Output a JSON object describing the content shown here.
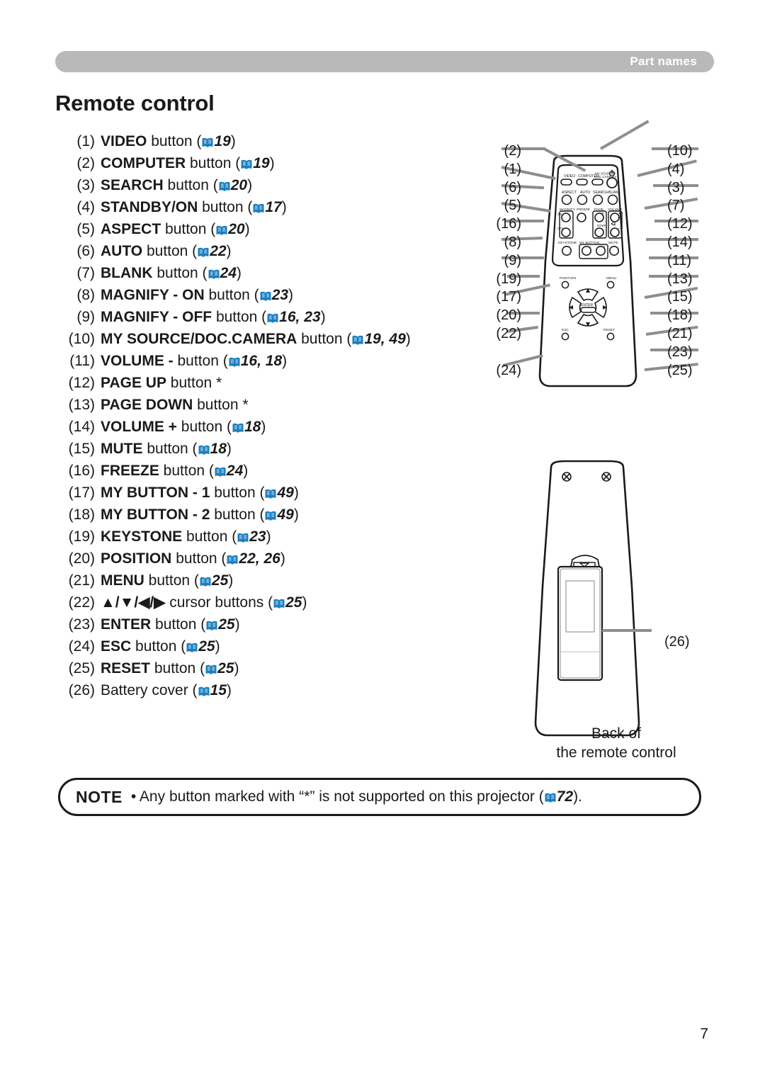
{
  "header": {
    "section_label": "Part names"
  },
  "page_title": "Remote control",
  "items": [
    {
      "num": "(1)",
      "bold": "VIDEO",
      "tail": " button (",
      "icon": "book-icon",
      "ref": "19",
      "close": ")"
    },
    {
      "num": "(2)",
      "bold": "COMPUTER",
      "tail": " button (",
      "icon": "book-icon",
      "ref": "19",
      "close": ")"
    },
    {
      "num": "(3)",
      "bold": "SEARCH",
      "tail": " button (",
      "icon": "book-icon",
      "ref": "20",
      "close": ")"
    },
    {
      "num": "(4)",
      "bold": "STANDBY/ON",
      "tail": " button (",
      "icon": "book-icon",
      "ref": "17",
      "close": ")"
    },
    {
      "num": "(5)",
      "bold": "ASPECT",
      "tail": " button (",
      "icon": "book-icon",
      "ref": "20",
      "close": ")"
    },
    {
      "num": "(6)",
      "bold": "AUTO",
      "tail": " button (",
      "icon": "book-icon",
      "ref": "22",
      "close": ")"
    },
    {
      "num": "(7)",
      "bold": "BLANK",
      "tail": " button (",
      "icon": "book-icon",
      "ref": "24",
      "close": ")"
    },
    {
      "num": "(8)",
      "bold": "MAGNIFY - ON",
      "tail": " button (",
      "icon": "book-icon",
      "ref": "23",
      "close": ")"
    },
    {
      "num": "(9)",
      "bold": "MAGNIFY - OFF",
      "tail": " button (",
      "icon": "book-icon",
      "ref": "16, 23",
      "close": ")"
    },
    {
      "num": "(10)",
      "bold": "MY SOURCE/DOC.CAMERA",
      "tail": " button (",
      "icon": "book-icon",
      "ref": "19, 49",
      "close": ")"
    },
    {
      "num": "(11)",
      "bold": "VOLUME -",
      "tail": " button (",
      "icon": "book-icon",
      "ref": "16, 18",
      "close": ")"
    },
    {
      "num": "(12)",
      "bold": "PAGE UP",
      "tail": " button *",
      "icon": "",
      "ref": "",
      "close": ""
    },
    {
      "num": "(13)",
      "bold": "PAGE DOWN",
      "tail": " button *",
      "icon": "",
      "ref": "",
      "close": ""
    },
    {
      "num": "(14)",
      "bold": "VOLUME +",
      "tail": " button (",
      "icon": "book-icon",
      "ref": "18",
      "close": ")"
    },
    {
      "num": "(15)",
      "bold": "MUTE",
      "tail": " button (",
      "icon": "book-icon",
      "ref": "18",
      "close": ")"
    },
    {
      "num": "(16)",
      "bold": "FREEZE",
      "tail": " button (",
      "icon": "book-icon",
      "ref": "24",
      "close": ")"
    },
    {
      "num": "(17)",
      "bold": "MY BUTTON - 1",
      "tail": " button (",
      "icon": "book-icon",
      "ref": "49",
      "close": ")"
    },
    {
      "num": "(18)",
      "bold": "MY BUTTON - 2",
      "tail": " button (",
      "icon": "book-icon",
      "ref": "49",
      "close": ")"
    },
    {
      "num": "(19)",
      "bold": "KEYSTONE",
      "tail": " button (",
      "icon": "book-icon",
      "ref": "23",
      "close": ")"
    },
    {
      "num": "(20)",
      "bold": "POSITION",
      "tail": " button (",
      "icon": "book-icon",
      "ref": "22, 26",
      "close": ")"
    },
    {
      "num": "(21)",
      "bold": "MENU",
      "tail": " button (",
      "icon": "book-icon",
      "ref": "25",
      "close": ")"
    },
    {
      "num": "(22)",
      "bold": "▲/▼/◀/▶",
      "tail": " cursor buttons (",
      "icon": "book-icon",
      "ref": "25",
      "close": ")"
    },
    {
      "num": "(23)",
      "bold": "ENTER",
      "tail": " button (",
      "icon": "book-icon",
      "ref": "25",
      "close": ")"
    },
    {
      "num": "(24)",
      "bold": "ESC",
      "tail": " button (",
      "icon": "book-icon",
      "ref": "25",
      "close": ")"
    },
    {
      "num": "(25)",
      "bold": "RESET",
      "tail": " button (",
      "icon": "book-icon",
      "ref": "25",
      "close": ")"
    },
    {
      "num": "(26)",
      "plain": "Battery cover",
      "tail": " (",
      "icon": "book-icon",
      "ref": "15",
      "close": ")"
    }
  ],
  "figure": {
    "callouts_left": [
      "(2)",
      "(1)",
      "(6)",
      "(5)",
      "(16)",
      "(8)",
      "(9)",
      "(19)",
      "(17)",
      "(20)",
      "(22)",
      "(24)"
    ],
    "callouts_right": [
      "(10)",
      "(4)",
      "(3)",
      "(7)",
      "(12)",
      "(14)",
      "(11)",
      "(13)",
      "(15)",
      "(18)",
      "(21)",
      "(23)",
      "(25)"
    ],
    "back_callout": "(26)",
    "remote_button_labels": [
      "VIDEO",
      "COMPUTER",
      "MY SOURCE/",
      "DOC.CAMERA",
      "ASPECT",
      "AUTO",
      "SEARCH",
      "BLANK",
      "MAGNIFY",
      "FREEZE",
      "PAGE",
      "VOLUME",
      "ON",
      "OFF",
      "UP",
      "DOWN",
      "KEYSTONE",
      "MY BUTTON",
      "1",
      "2",
      "MUTE",
      "POSITION",
      "MENU",
      "ENTER",
      "ESC",
      "RESET"
    ],
    "caption_line1": "Back of",
    "caption_line2": "the remote control"
  },
  "note": {
    "label": "NOTE",
    "text_before": "• Any button marked with “*” is not supported on this projector (",
    "icon": "book-icon",
    "ref": "72",
    "text_after": ")."
  },
  "page_number": "7",
  "colors": {
    "header_bar": "#b9b9b9",
    "header_text": "#ffffff",
    "book_icon": "#1b7fc0",
    "leader_line": "#8e8e8e",
    "text": "#1a1a1a"
  }
}
